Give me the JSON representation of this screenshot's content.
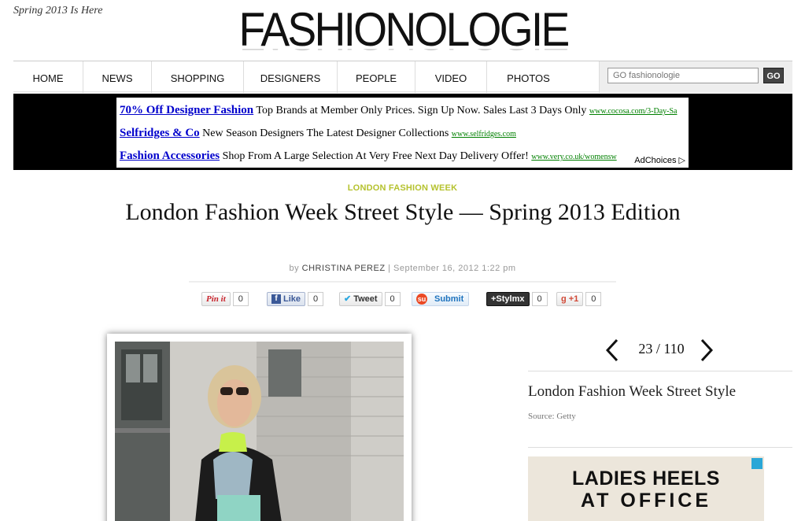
{
  "header": {
    "tagline": "Spring 2013 Is Here",
    "logo": "FASHIONOLOGIE"
  },
  "nav": {
    "items": [
      "HOME",
      "NEWS",
      "SHOPPING",
      "DESIGNERS",
      "PEOPLE",
      "VIDEO",
      "PHOTOS"
    ],
    "search_placeholder": "GO fashionologie",
    "search_button": "GO"
  },
  "ads": {
    "lines": [
      {
        "link": "70% Off Designer Fashion",
        "text": "Top Brands at Member Only Prices. Sign Up Now. Sales Last 3 Days Only",
        "url": "www.cocosa.com/3-Day-Sa"
      },
      {
        "link": "Selfridges & Co",
        "text": "New Season Designers The Latest Designer Collections",
        "url": "www.selfridges.com"
      },
      {
        "link": "Fashion Accessories",
        "text": "Shop From A Large Selection At Very Free Next Day Delivery Offer!",
        "url": "www.very.co.uk/womensw"
      }
    ],
    "adchoices": "AdChoices"
  },
  "article": {
    "category": "LONDON FASHION WEEK",
    "title": "London Fashion Week Street Style — Spring 2013 Edition",
    "by": "by",
    "author": "CHRISTINA PEREZ",
    "date": "September 16, 2012 1:22 pm"
  },
  "share": {
    "pinit": {
      "label": "Pin it",
      "count": "0"
    },
    "like": {
      "label": "Like",
      "count": "0"
    },
    "tweet": {
      "label": "Tweet",
      "count": "0"
    },
    "stumble": {
      "label": "Submit"
    },
    "stylmx": {
      "label": "+Stylmx",
      "count": "0"
    },
    "gplus": {
      "label": "+1",
      "count": "0"
    }
  },
  "gallery": {
    "counter": "23 / 110",
    "slide_title": "London Fashion Week Street Style",
    "source": "Source: Getty"
  },
  "sidebar_ad": {
    "line1": "LADIES HEELS",
    "line2": "AT OFFICE"
  },
  "colors": {
    "accent": "#b5c22e",
    "ad_link": "#0000cc",
    "ad_url": "#008000"
  }
}
